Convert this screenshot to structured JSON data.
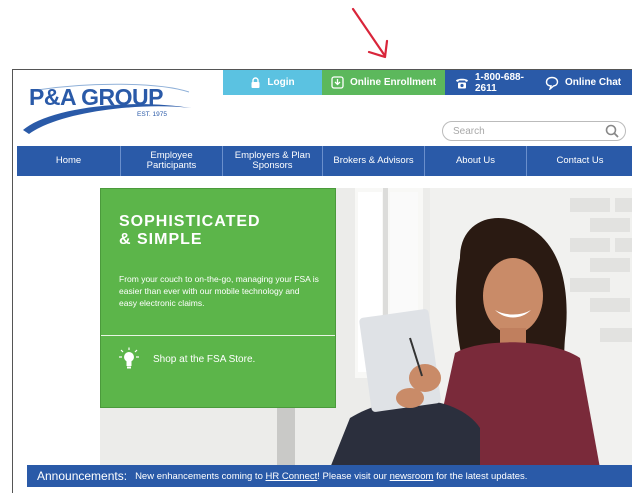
{
  "logo": {
    "name": "P&A GROUP",
    "tagline": "EST. 1975"
  },
  "topbar": {
    "login": "Login",
    "enrollment": "Online Enrollment",
    "phone": "1-800-688-2611",
    "chat": "Online Chat"
  },
  "search": {
    "placeholder": "Search"
  },
  "nav": {
    "items": [
      {
        "label": "Home"
      },
      {
        "label": "Employee Participants"
      },
      {
        "label": "Employers & Plan Sponsors"
      },
      {
        "label": "Brokers & Advisors"
      },
      {
        "label": "About Us"
      },
      {
        "label": "Contact Us"
      }
    ]
  },
  "promo": {
    "title": "SOPHISTICATED\n& SIMPLE",
    "text": "From your couch to on-the-go, managing your FSA is easier than ever with our mobile technology and easy electronic claims.",
    "shop": "Shop at the FSA Store."
  },
  "announcement": {
    "heading": "Announcements:",
    "text_before": "New enhancements coming to",
    "link1": "HR Connect",
    "text_middle": "! Please visit our",
    "link2": "newsroom",
    "text_after": "for the latest updates."
  },
  "colors": {
    "brand_blue": "#2a5aa8",
    "green": "#5cb85c",
    "light_blue": "#5bc2e1",
    "arrow_red": "#d9253a"
  }
}
